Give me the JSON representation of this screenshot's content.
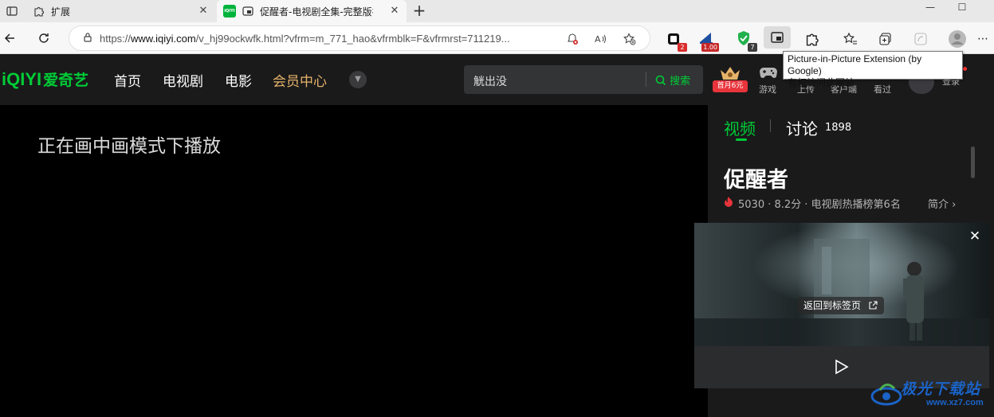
{
  "browser": {
    "tabs": [
      {
        "title": "扩展"
      },
      {
        "title": "促醒者-电视剧全集-完整版视频在线观看-爱奇艺",
        "favicon_text": "iQIYI"
      }
    ],
    "new_tab_symbol": "+",
    "window_controls": {
      "minimize": "—",
      "maximize": "☐"
    },
    "address": {
      "url_prefix": "https://",
      "host": "www.iqiyi.com",
      "url_rest": "/v_hj99ockwfk.html?vfrm=m_771_hao&vfrmblk=F&vfrmrst=711219..."
    },
    "extensions": [
      {
        "name": "extension-1",
        "badge": "2",
        "badge_color": "#d92c2c"
      },
      {
        "name": "extension-2",
        "badge": "1.00",
        "badge_color": "#c62828"
      },
      {
        "name": "adguard",
        "badge": "7",
        "badge_color": "#3d3d3d"
      }
    ],
    "tooltip": {
      "line1": "Picture-in-Picture Extension (by Google)",
      "line2": "有权访问此网站"
    }
  },
  "site": {
    "logo": {
      "en": "iQIYI",
      "cn": "爱奇艺"
    },
    "nav": [
      {
        "label": "首页"
      },
      {
        "label": "电视剧"
      },
      {
        "label": "电影"
      },
      {
        "label": "会员中心"
      }
    ],
    "search": {
      "query": "觥出没",
      "button": "搜索"
    },
    "vip_tag": "首月6元",
    "header_items": [
      {
        "label": "游戏"
      },
      {
        "label": "上传"
      },
      {
        "label": "客户端"
      },
      {
        "label": "看过"
      }
    ],
    "login": "登录"
  },
  "player": {
    "pip_message": "正在画中画模式下播放"
  },
  "side": {
    "tabs": [
      {
        "label": "视频"
      },
      {
        "label": "讨论"
      }
    ],
    "comment_count": "1898",
    "show_title": "促醒者",
    "stats": "5030 · 8.2分 · 电视剧热播榜第6名",
    "intro": "简介 ›"
  },
  "pip": {
    "back_to_tab": "返回到标签页"
  },
  "watermark": {
    "title": "极光下载站",
    "url": "www.xz7.com"
  },
  "colors": {
    "brand_green": "#00cc36",
    "vip_gold": "#e5b36a",
    "header_bg": "#1a1a1b"
  }
}
